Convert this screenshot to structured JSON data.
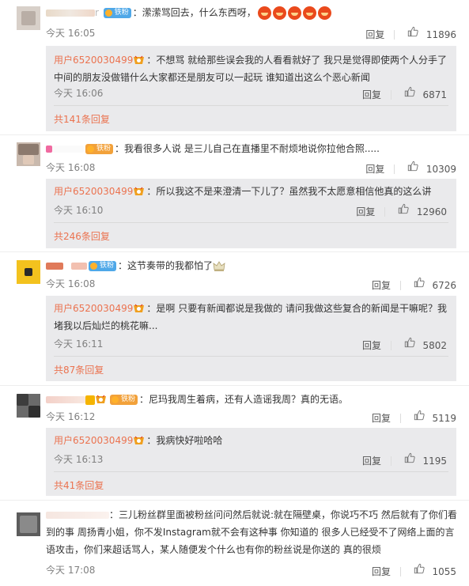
{
  "common": {
    "reply_label": "回复",
    "separator": "：",
    "fan_badge": "铁粉",
    "replier_name": "用户6520030499"
  },
  "comments": [
    {
      "text": "潆潆骂回去，什么东西呀，",
      "time": "今天 16:05",
      "likes": "11896",
      "partial_name": "r",
      "reply": {
        "text": "不想骂 就给那些误会我的人看看就好了 我只是觉得即使两个人分手了中间的朋友没做错什么大家都还是朋友可以一起玩 谁知道出这么个恶心新闻",
        "time": "今天 16:06",
        "likes": "6871",
        "more": "共141条回复"
      }
    },
    {
      "text": "我看很多人说 是三儿自己在直播里不耐烦地说你拉他合照.....",
      "time": "今天 16:08",
      "likes": "10309",
      "reply": {
        "text": "所以我这不是来澄清一下儿了？虽然我不太愿意相信他真的这么讲",
        "time": "今天 16:10",
        "likes": "12960",
        "more": "共246条回复"
      }
    },
    {
      "text": "这节奏带的我都怕了",
      "time": "今天 16:08",
      "likes": "6726",
      "reply": {
        "text": "是啊 只要有新闻都说是我做的 请问我做这些复合的新闻是干嘛呢？我堵我以后灿烂的桃花嘛...",
        "time": "今天 16:11",
        "likes": "5802",
        "more": "共87条回复"
      }
    },
    {
      "text": "尼玛我周生着病，还有人造谣我周？真的无语。",
      "time": "今天 16:12",
      "likes": "5119",
      "reply": {
        "text": "我病快好啦哈哈",
        "time": "今天 16:13",
        "likes": "1195",
        "more": "共41条回复"
      }
    },
    {
      "text": "三儿粉丝群里面被粉丝问问然后就说:就在隔壁桌，你说巧不巧 然后就有了你们看到的事 周扬青小姐，你不发Instagram就不会有这种事 你知道的 很多人已经受不了网络上面的言语攻击，你们来超话骂人，某人随便发个什么也有你的粉丝说是你送的 真的很烦",
      "time": "今天 17:08",
      "likes": "1055"
    }
  ]
}
